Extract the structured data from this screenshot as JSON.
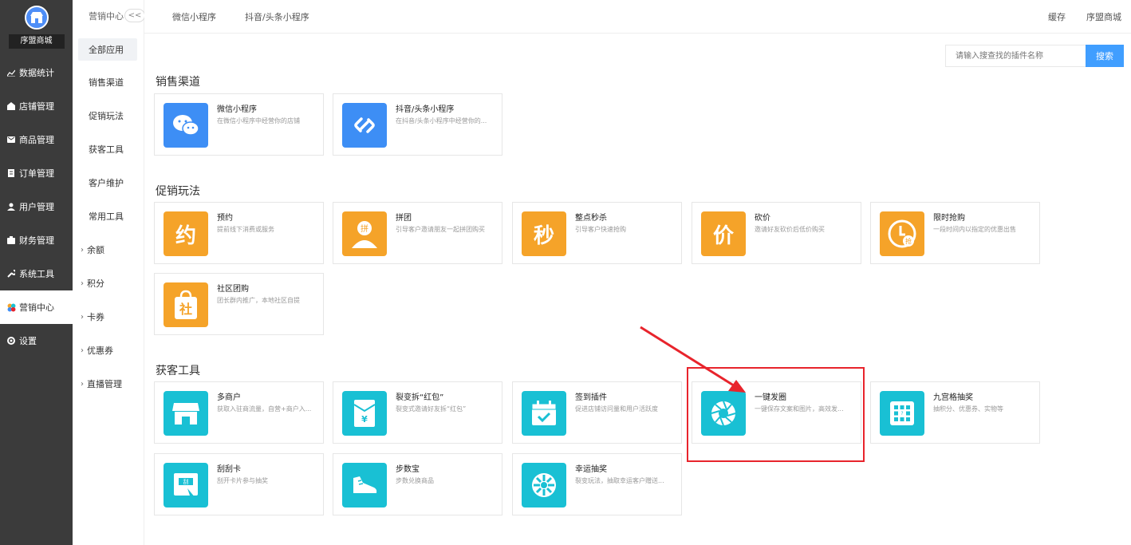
{
  "sidebar": {
    "shop_name": "序盟商城",
    "items": [
      {
        "label": "数据统计",
        "icon": "chart-icon"
      },
      {
        "label": "店铺管理",
        "icon": "shop-icon"
      },
      {
        "label": "商品管理",
        "icon": "goods-icon"
      },
      {
        "label": "订单管理",
        "icon": "order-icon"
      },
      {
        "label": "用户管理",
        "icon": "user-icon"
      },
      {
        "label": "财务管理",
        "icon": "finance-icon"
      },
      {
        "label": "系统工具",
        "icon": "wrench-icon"
      },
      {
        "label": "营销中心",
        "icon": "marketing-icon"
      },
      {
        "label": "设置",
        "icon": "gear-icon"
      }
    ]
  },
  "subbar": {
    "title": "营销中心",
    "collapse_label": "<<",
    "items": [
      {
        "label": "全部应用"
      },
      {
        "label": "销售渠道"
      },
      {
        "label": "促销玩法"
      },
      {
        "label": "获客工具"
      },
      {
        "label": "客户维护"
      },
      {
        "label": "常用工具"
      },
      {
        "label": "余额"
      },
      {
        "label": "积分"
      },
      {
        "label": "卡券"
      },
      {
        "label": "优惠券"
      },
      {
        "label": "直播管理"
      }
    ]
  },
  "topbar": {
    "tabs": [
      {
        "label": "微信小程序"
      },
      {
        "label": "抖音/头条小程序"
      }
    ],
    "right": [
      {
        "label": "缓存"
      },
      {
        "label": "序盟商城"
      }
    ]
  },
  "search": {
    "placeholder": "请输入搜查找的插件名称",
    "button_label": "搜索"
  },
  "sections": [
    {
      "title": "销售渠道",
      "cards": [
        {
          "name": "微信小程序",
          "desc": "在微信小程序中经营你的店铺",
          "icon": "wechat-icon",
          "color": "#3d8ef5"
        },
        {
          "name": "抖音/头条小程序",
          "desc": "在抖音/头条小程序中经营你的...",
          "icon": "douyin-icon",
          "color": "#3d8ef5"
        }
      ]
    },
    {
      "title": "促销玩法",
      "cards": [
        {
          "name": "预约",
          "desc": "提前线下消费或服务",
          "icon_char": "约",
          "color": "#f5a329"
        },
        {
          "name": "拼团",
          "desc": "引导客户邀请朋友一起拼团购买",
          "icon": "group-buy-icon",
          "icon_char": "拼",
          "color": "#f5a329"
        },
        {
          "name": "整点秒杀",
          "desc": "引导客户快速抢购",
          "icon_char": "秒",
          "color": "#f5a329"
        },
        {
          "name": "砍价",
          "desc": "邀请好友砍价后低价购买",
          "icon_char": "价",
          "color": "#f5a329"
        },
        {
          "name": "限时抢购",
          "desc": "一段时间内以指定的优惠出售",
          "icon": "clock-icon",
          "icon_char": "抢",
          "color": "#f5a329"
        },
        {
          "name": "社区团购",
          "desc": "团长群内推广，本地社区自提",
          "icon": "bag-icon",
          "icon_char": "社",
          "color": "#f5a329"
        }
      ]
    },
    {
      "title": "获客工具",
      "cards": [
        {
          "name": "多商户",
          "desc": "获取入驻商流量，自营+商户入...",
          "icon": "store-icon",
          "color": "#19c0d4"
        },
        {
          "name": "裂变拆“红包”",
          "desc": "裂变式邀请好友拆“红包”",
          "icon": "red-packet-icon",
          "color": "#19c0d4"
        },
        {
          "name": "签到插件",
          "desc": "促进店铺访问量和用户活跃度",
          "icon": "calendar-check-icon",
          "color": "#19c0d4"
        },
        {
          "name": "一键发圈",
          "desc": "一键保存文案和图片，高效发...",
          "icon": "aperture-icon",
          "color": "#19c0d4"
        },
        {
          "name": "九宫格抽奖",
          "desc": "抽积分、优惠券、实物等",
          "icon": "grid-lottery-icon",
          "color": "#19c0d4"
        },
        {
          "name": "刮刮卡",
          "desc": "刮开卡片参与抽奖",
          "icon": "scratch-card-icon",
          "icon_char": "刮",
          "color": "#19c0d4"
        },
        {
          "name": "步数宝",
          "desc": "步数兑换商品",
          "icon": "shoe-icon",
          "color": "#19c0d4"
        },
        {
          "name": "幸运抽奖",
          "desc": "裂变玩法，抽取幸运客户赠送...",
          "icon": "wheel-icon",
          "color": "#19c0d4"
        }
      ]
    }
  ],
  "annotation": {
    "color": "#e8242c"
  }
}
